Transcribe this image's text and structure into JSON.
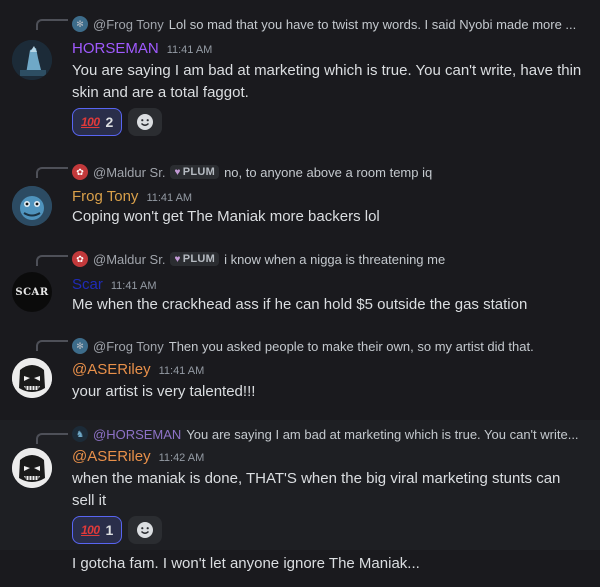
{
  "messages": [
    {
      "reply": {
        "name": "@Frog Tony",
        "text": "Lol so mad that you have to twist my words. I said Nyobi made more ..."
      },
      "author": "HORSEMAN",
      "author_color": "#a05aff",
      "time": "11:41 AM",
      "body": "You are saying I am bad at marketing which is true. You can't write, have thin skin and are a total faggot.",
      "reaction": {
        "emoji": "💯",
        "count": "2"
      }
    },
    {
      "reply": {
        "name": "@Maldur Sr.",
        "tag": "PLUM",
        "text": "no, to anyone above a room temp iq"
      },
      "author": "Frog Tony",
      "author_color": "#d9a04a",
      "time": "11:41 AM",
      "body": "Coping won't get The Maniak more backers lol"
    },
    {
      "reply": {
        "name": "@Maldur Sr.",
        "tag": "PLUM",
        "text": "i know when a nigga is threatening me"
      },
      "author": "Scar",
      "author_color": "#1f2bb8",
      "time": "11:41 AM",
      "avatar_text": "SCAR",
      "body": "Me when the crackhead ass if he can hold $5 outside the gas station"
    },
    {
      "reply": {
        "name": "@Frog Tony",
        "text": "Then you asked people to make their own, so my artist did that."
      },
      "author": "@ASERiley",
      "author_color": "#e8904a",
      "time": "11:41 AM",
      "body": "your artist is very talented!!!"
    },
    {
      "reply": {
        "name": "@HORSEMAN",
        "text": "You are saying I am bad at marketing which is true. You can't write..."
      },
      "author": "@ASERiley",
      "author_color": "#e8904a",
      "time": "11:42 AM",
      "body": "when the maniak is done, THAT'S when the big viral marketing stunts can sell it",
      "reaction": {
        "emoji": "💯",
        "count": "1"
      }
    }
  ],
  "followup": "I gotcha fam. I won't let anyone ignore The Maniak...",
  "icons": {
    "add_reaction": "smiley-add-icon",
    "reaction_emoji": "hundred-points-icon",
    "plum_badge": "heart-icon"
  }
}
